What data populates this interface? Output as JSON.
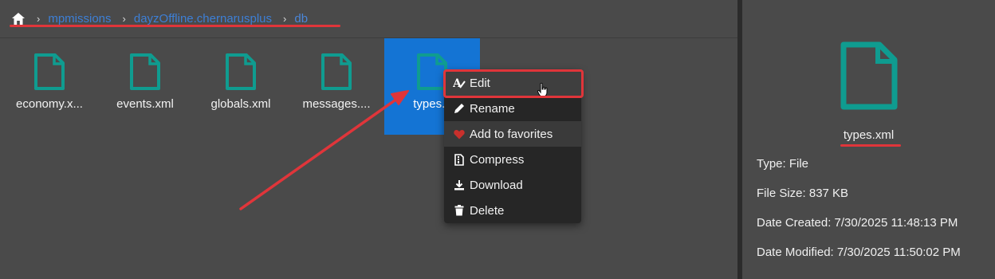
{
  "breadcrumb": {
    "home_icon": "home-icon",
    "separator": "›",
    "items": [
      "mpmissions",
      "dayzOffline.chernarusplus",
      "db"
    ]
  },
  "files": [
    {
      "name": "economy.x...",
      "icon": "file-icon"
    },
    {
      "name": "events.xml",
      "icon": "file-icon"
    },
    {
      "name": "globals.xml",
      "icon": "file-icon"
    },
    {
      "name": "messages....",
      "icon": "file-icon"
    },
    {
      "name": "types.x",
      "icon": "file-icon",
      "selected": true
    }
  ],
  "context_menu": {
    "items": [
      {
        "label": "Edit",
        "icon": "edit-text-icon"
      },
      {
        "label": "Rename",
        "icon": "pencil-icon"
      },
      {
        "label": "Add to favorites",
        "icon": "heart-icon"
      },
      {
        "label": "Compress",
        "icon": "archive-icon"
      },
      {
        "label": "Download",
        "icon": "download-icon"
      },
      {
        "label": "Delete",
        "icon": "trash-icon"
      }
    ]
  },
  "details": {
    "name": "types.xml",
    "type": "Type: File",
    "size": "File Size: 837 KB",
    "created": "Date Created: 7/30/2025 11:48:13 PM",
    "modified": "Date Modified: 7/30/2025 11:50:02 PM"
  },
  "colors": {
    "background": "#4a4a4a",
    "accent_teal": "#0f9c90",
    "selection_blue": "#1474d4",
    "link_blue": "#3d7fd6",
    "annotation_red": "#e0353a",
    "menu_bg": "#262626"
  }
}
